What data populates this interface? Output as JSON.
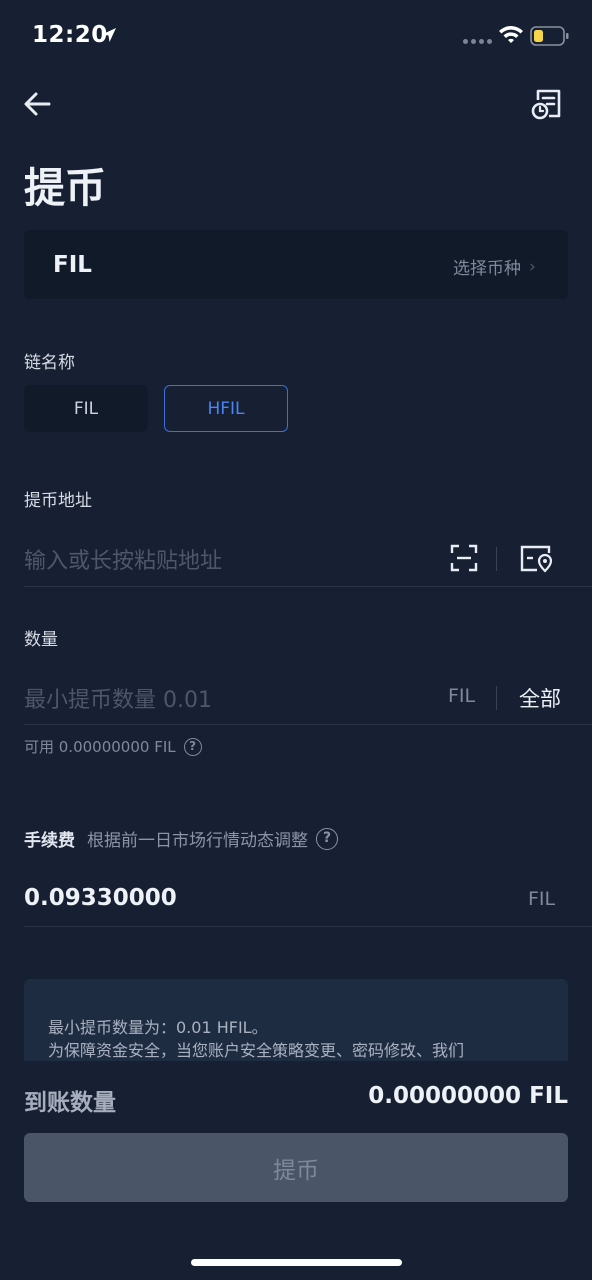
{
  "status_bar": {
    "time": "12:20",
    "icons": [
      "location-arrow-icon",
      "cellular-dots-icon",
      "wifi-icon",
      "battery-icon"
    ]
  },
  "header": {
    "title": "提币",
    "icons": [
      "back-arrow-icon",
      "history-record-icon"
    ]
  },
  "coin_select": {
    "coin": "FIL",
    "action_label": "选择币种",
    "chevron": "›"
  },
  "chain": {
    "label": "链名称",
    "options": [
      "FIL",
      "HFIL"
    ],
    "selected": "HFIL"
  },
  "address": {
    "label": "提币地址",
    "placeholder": "输入或长按粘贴地址",
    "icons": [
      "scan-icon",
      "address-book-icon"
    ]
  },
  "amount": {
    "label": "数量",
    "placeholder": "最小提币数量 0.01",
    "unit": "FIL",
    "all_label": "全部",
    "available": "可用 0.00000000 FIL"
  },
  "fee": {
    "label": "手续费",
    "note": "根据前一日市场行情动态调整",
    "value": "0.09330000",
    "unit": "FIL"
  },
  "notice": {
    "line1": "最小提币数量为：0.01 HFIL。",
    "line2": "为保障资金安全，当您账户安全策略变更、密码修改、我们"
  },
  "receive": {
    "label": "到账数量",
    "value": "0.00000000 FIL"
  },
  "submit_label": "提币",
  "colors": {
    "background": "#172033",
    "accent": "#3b6fd9",
    "card": "#111a29",
    "button_disabled": "#4a5568"
  }
}
